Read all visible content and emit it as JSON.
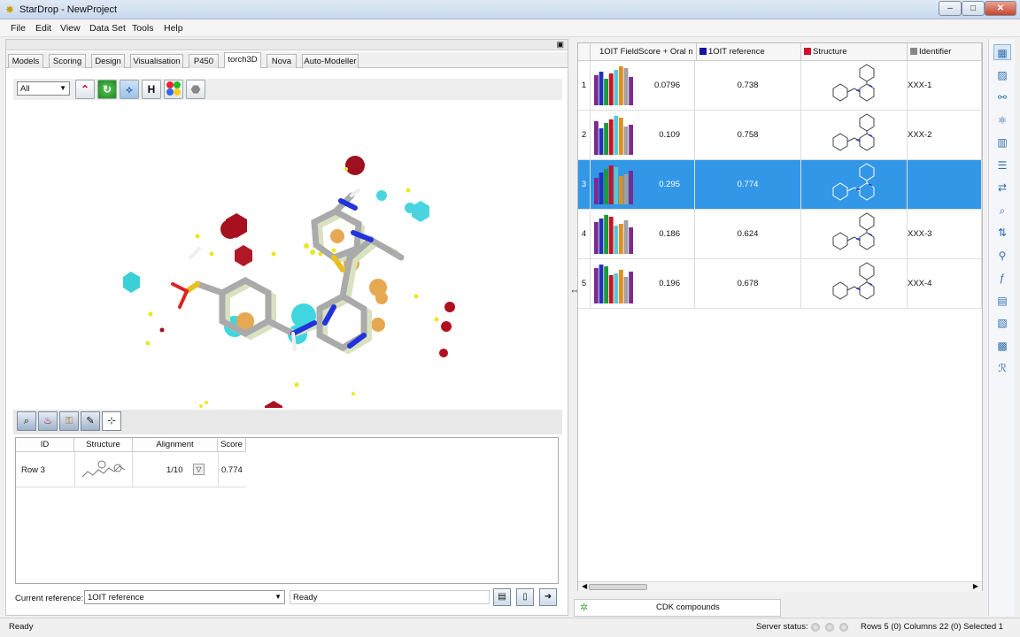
{
  "window": {
    "app_icon": "starburst-icon",
    "title": "StarDrop - NewProject",
    "min": "–",
    "max": "□",
    "close": "✕"
  },
  "menu": [
    "File",
    "Edit",
    "View",
    "Data Set",
    "Tools",
    "Help"
  ],
  "tabs": [
    "Models",
    "Scoring",
    "Design",
    "Visualisation",
    "P450",
    "torch3D",
    "Nova",
    "Auto-Modeller"
  ],
  "active_tab": "torch3D",
  "toolbar3d": {
    "filter_value": "All",
    "hydrogen_label": "H",
    "icons": [
      "surface-icon",
      "refresh-icon",
      "field-points-icon",
      "hydrogen-icon",
      "color-atoms-icon",
      "mesh-icon"
    ]
  },
  "viewer_tools": [
    "search-molecule-icon",
    "fire-extinguisher-icon",
    "lock-molecule-icon",
    "tools-icon",
    "fit-view-icon"
  ],
  "alignment_table": {
    "columns": [
      "ID",
      "Structure",
      "Alignment",
      "Score"
    ],
    "rows": [
      {
        "id": "Row 3",
        "alignment": "1/10",
        "score": "0.774"
      }
    ]
  },
  "reference": {
    "label": "Current reference:",
    "value": "1OIT reference"
  },
  "status_field": "Ready",
  "bottom_buttons": [
    "save-icon",
    "new-document-icon",
    "export-icon"
  ],
  "grid": {
    "columns": [
      {
        "label": "1OIT FieldScore + Oral n",
        "swatch": null
      },
      {
        "label": "1OIT reference",
        "swatch": "#1414a0"
      },
      {
        "label": "Structure",
        "swatch": "#d01030"
      },
      {
        "label": "Identifier",
        "swatch": "#888888"
      }
    ],
    "rows": [
      {
        "num": "1",
        "fieldscore": "0.0796",
        "reference": "0.738",
        "identifier": "XXX-1",
        "selected": false
      },
      {
        "num": "2",
        "fieldscore": "0.109",
        "reference": "0.758",
        "identifier": "XXX-2",
        "selected": false
      },
      {
        "num": "3",
        "fieldscore": "0.295",
        "reference": "0.774",
        "identifier": "",
        "selected": true
      },
      {
        "num": "4",
        "fieldscore": "0.186",
        "reference": "0.624",
        "identifier": "XXX-3",
        "selected": false
      },
      {
        "num": "5",
        "fieldscore": "0.196",
        "reference": "0.678",
        "identifier": "XXX-4",
        "selected": false
      }
    ],
    "bar_colors": [
      "#7b2a8f",
      "#2233bb",
      "#1a9a3a",
      "#cc1122",
      "#58c8d8",
      "#e09020",
      "#a0a0a0",
      "#7b2a8f"
    ]
  },
  "dataset_tab": "CDK compounds",
  "statusbar": {
    "left": "Ready",
    "server_label": "Server status:",
    "info": "Rows 5 (0) Columns 22 (0) Selected 1"
  },
  "sidebar_icons": [
    "table-view-icon",
    "chart-icon",
    "molecule-group-icon",
    "atom-icon",
    "grid-icon",
    "list-icon",
    "transform-icon",
    "zoom-icon",
    "sort-icon",
    "filter-icon",
    "function-icon",
    "columns-icon",
    "export-table-icon",
    "matrix-icon",
    "r-group-icon"
  ]
}
